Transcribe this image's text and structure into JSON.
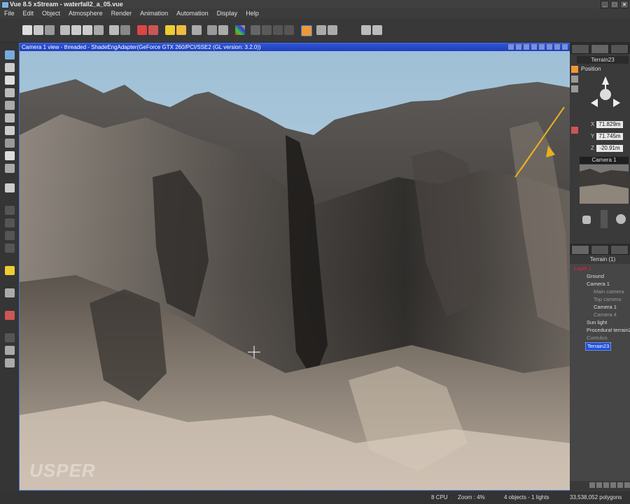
{
  "window": {
    "title": "Vue 8.5 xStream - waterfall2_a_05.vue",
    "buttons": [
      "_",
      "□",
      "×"
    ]
  },
  "menu": [
    "File",
    "Edit",
    "Object",
    "Atmosphere",
    "Render",
    "Animation",
    "Automation",
    "Display",
    "Help"
  ],
  "viewport": {
    "header": "Camera 1 view - threaded - ShadeEngAdapter(GeForce GTX 260/PCI/SSE2 (GL version: 3.2.0))",
    "watermark": "USPER"
  },
  "panel": {
    "object_name": "Terrain23",
    "position_label": "Position",
    "coords": [
      {
        "axis": "X",
        "value": "71.829m"
      },
      {
        "axis": "Y",
        "value": "71.745m"
      },
      {
        "axis": "Z",
        "value": "-20.91m"
      }
    ],
    "camera_header": "Camera 1"
  },
  "tree": {
    "header": "Terrain (1)",
    "items": [
      {
        "label": "Layer 1",
        "style": "red"
      },
      {
        "label": "Ground",
        "style": ""
      },
      {
        "label": "Camera 1",
        "style": ""
      },
      {
        "label": "Main camera",
        "style": "dim"
      },
      {
        "label": "Top camera",
        "style": "dim"
      },
      {
        "label": "Camera 1",
        "style": ""
      },
      {
        "label": "Camera 4",
        "style": "dim"
      },
      {
        "label": "Sun light",
        "style": ""
      },
      {
        "label": "Procedural terrain2",
        "style": ""
      },
      {
        "label": "Cumulus",
        "style": "dim"
      },
      {
        "label": "Terrain23",
        "style": "sel"
      }
    ]
  },
  "status": {
    "cpu": "8 CPU",
    "zoom": "Zoom : 4%",
    "objects": "4 objects - 1 lights",
    "polygons": "33,538,052 polygons"
  },
  "colors": {
    "viewport_header": "#2f55d8",
    "selection": "#1f4fd8",
    "sky": "#a9c6d8",
    "rock": "#8a8178"
  }
}
